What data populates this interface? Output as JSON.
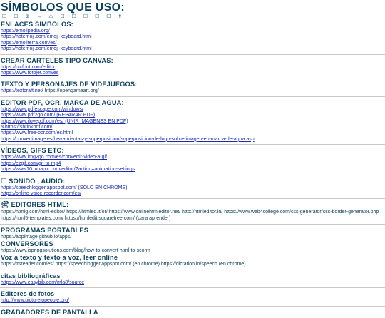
{
  "title": "SÍMBOLOS QUE USO:",
  "symbols_line": "☐ ☐ ⊕ ↔ ⚠ ☐ ☐ ☐ ☐ ☐ ⬆",
  "sections": {
    "enlaces": {
      "heading": "ENLACES SÍMBOLOS:",
      "links": [
        "https://emojipedia.org/",
        "https://hotemoji.com/emoji-keyboard.html",
        "https://emojiterra.com/es/",
        "https://hotemoji.com/emoji-keyboard.html"
      ]
    },
    "carteles": {
      "heading": "CREAR CARTELES TIPO CANVAS:",
      "links": [
        "https://picfont.com/editor",
        "https://www.fotojet.com/es"
      ]
    },
    "texto": {
      "heading": "TEXTO Y PERSONAJES DE VIDEJUEGOS:",
      "link": "https://textcraft.net/",
      "extra": " https://opengameart.org/"
    },
    "pdf": {
      "heading": "EDITOR PDF, OCR, MARCA DE AGUA:",
      "links": [
        "https://www.pdfescape.com/windows/",
        "https://www.pdf2go.com/ (REPARAR PDF)",
        "https://www.ilovepdf.com/es/ (UNIR IMAGENES EN PDF)",
        "✎https://shrinkpdf.com/",
        "https://www.free-ocr.com/es.html",
        "https://convertimage.es/herramientas-y-superposicion/superposicion-de-logo-sobre-imagen-en-marca-de-agua.asp"
      ]
    },
    "videos": {
      "heading": "VÍDEOS, GIFS ETC:",
      "links": [
        "https://www.img2go.com/es/convertir-video-a-gif",
        "https://ezgif.com/gif-to-mp4",
        "https://www10.lunapic.com/editor/?action=animation-settings"
      ]
    },
    "sonido": {
      "heading": "☐ SONIDO , AUDIO:",
      "links": [
        "https://speechlogger.appspot.com/ (SOLO EN CHROME)",
        "https://online-voice-recorder.com/es/"
      ]
    },
    "html": {
      "heading": "🛠 EDITORES HTML:",
      "text": "https://htmlg.com/html-editor/ https://htmled.it/or/ https://www.onlinehtmleditor.net/ http://htmleditor.in/ https://www.web4college.com/css-generator/css-border-generator.php https://html5-templates.com/ https://htmledit.squarefree.com/ (para aprender)"
    },
    "portables": {
      "heading": "PROGRAMAS PORTABLES",
      "text": "https://appimage.github.io/apps/"
    },
    "conversores": {
      "heading": "CONVERSORES",
      "text": "https://www.ispringsolutions.com/blog/how-to-convert-html-to-scorm"
    },
    "voz": {
      "heading": "Voz a texto y texto a voz, leer online",
      "text": "https://ttsreader.com/es/ https://speechlogger.appspot.com/ (en chrome) https://dictation.io/speech (en chrome)"
    },
    "citas": {
      "heading": "citas bibliográficas",
      "link": "https://www.easybib.com/mla8/source"
    },
    "fotos": {
      "heading": "Editores de fotos",
      "link": "http://www.picturetopeople.org/"
    },
    "grabadores": {
      "heading": "GRABADORES DE PANTALLA"
    }
  }
}
